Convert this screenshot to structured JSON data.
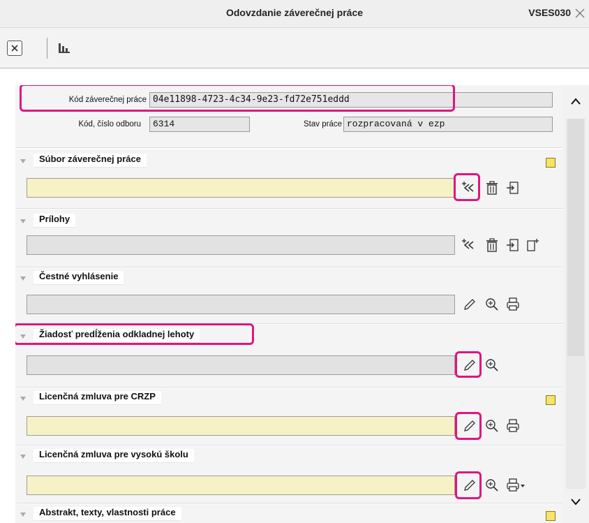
{
  "window": {
    "title": "Odovzdanie záverečnej práce",
    "code": "VSES030"
  },
  "header": {
    "thesis_code_label": "Kód záverečnej práce",
    "thesis_code_value": "04e11898-4723-4c34-9e23-fd72e751eddd",
    "dept_label": "Kód, číslo odboru",
    "dept_value": "6314",
    "status_label": "Stav práce",
    "status_value": "rozpracovaná v ezp"
  },
  "sections": [
    {
      "title": "Súbor záverečnej práce",
      "field": "",
      "icons": [
        "add-arrows-icon",
        "trash-icon",
        "export-icon"
      ],
      "highlight": "add-arrows-icon",
      "warning": true
    },
    {
      "title": "Prílohy",
      "field": "",
      "icons": [
        "add-arrows-icon",
        "trash-icon",
        "export-icon",
        "new-file-icon"
      ]
    },
    {
      "title": "Čestné vyhlásenie",
      "field": "",
      "icons": [
        "pencil-icon",
        "zoom-icon",
        "print-icon"
      ]
    },
    {
      "title": "Žiadosť predĺženia odkladnej lehoty",
      "field": "",
      "icons": [
        "pencil-icon",
        "zoom-icon"
      ],
      "highlight": "pencil-icon"
    },
    {
      "title": "Licenčná zmluva pre CRZP",
      "field": "",
      "icons": [
        "pencil-icon",
        "zoom-icon",
        "print-icon"
      ],
      "highlight": "pencil-icon",
      "warning": true
    },
    {
      "title": "Licenčná zmluva pre vysokú školu",
      "field": "",
      "icons": [
        "pencil-icon",
        "zoom-icon",
        "print-menu-icon"
      ],
      "highlight": "pencil-icon"
    },
    {
      "title": "Abstrakt, texty, vlastnosti práce",
      "field": "",
      "icons": [],
      "warning": true
    }
  ],
  "colors": {
    "highlight": "#e0157f",
    "yellow_field": "#f7f2c6",
    "gray_field": "#e2e2e2"
  }
}
